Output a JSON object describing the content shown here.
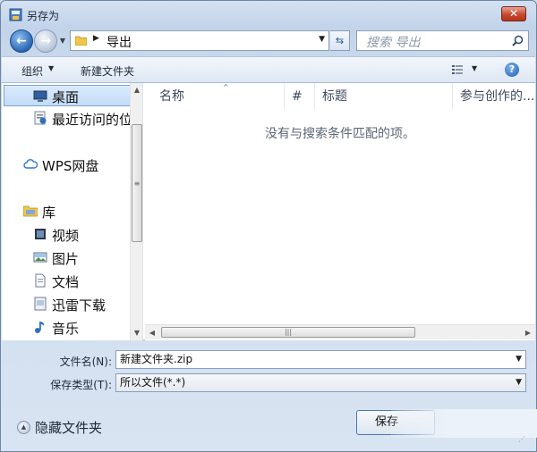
{
  "window": {
    "title": "另存为",
    "close_glyph": "✕"
  },
  "nav": {
    "back_glyph": "←",
    "forward_glyph": "→",
    "address": {
      "crumb": "导出"
    },
    "search_placeholder": "搜索 导出"
  },
  "toolbar": {
    "organize_label": "组织",
    "new_folder_label": "新建文件夹",
    "help_glyph": "?"
  },
  "sidebar": {
    "items": [
      {
        "label": "桌面",
        "icon": "desktop-icon",
        "selected": true
      },
      {
        "label": "最近访问的位置",
        "icon": "recent-places-icon"
      },
      {
        "label": "WPS网盘",
        "icon": "cloud-icon"
      },
      {
        "label": "库",
        "icon": "library-folder-icon"
      },
      {
        "label": "视频",
        "icon": "video-icon"
      },
      {
        "label": "图片",
        "icon": "picture-icon"
      },
      {
        "label": "文档",
        "icon": "document-icon"
      },
      {
        "label": "迅雷下载",
        "icon": "download-folder-icon"
      },
      {
        "label": "音乐",
        "icon": "music-icon"
      }
    ]
  },
  "file_list": {
    "columns": [
      "名称",
      "#",
      "标题",
      "参与创作的..."
    ],
    "empty_message": "没有与搜索条件匹配的项。"
  },
  "form": {
    "filename_label": "文件名(N):",
    "filename_value": "新建文件夹.zip",
    "type_label": "保存类型(T):",
    "type_value": "所以文件(*.*)"
  },
  "footer": {
    "hide_folders_label": "隐藏文件夹",
    "save_label": "保存"
  },
  "colors": {
    "accent": "#2a67b5",
    "close": "#c8472f"
  }
}
